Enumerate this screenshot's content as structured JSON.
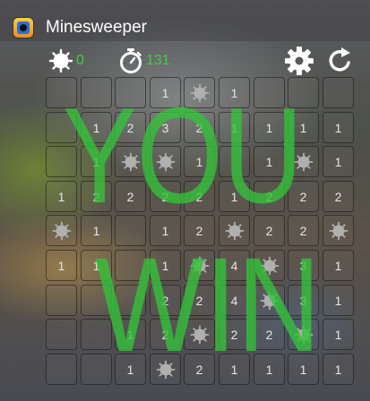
{
  "app": {
    "title": "Minesweeper"
  },
  "toolbar": {
    "flags": "0",
    "time": "131"
  },
  "colors": {
    "accent": "#3fd13c",
    "overlay": "#35c23b"
  },
  "overlay": {
    "line1": "YOU",
    "line2": "WIN"
  },
  "board": {
    "rows": [
      [
        "",
        "",
        "",
        "1",
        "m",
        "1",
        "",
        "",
        ""
      ],
      [
        "",
        "1",
        "2",
        "3",
        "2",
        "1",
        "1",
        "1",
        "1"
      ],
      [
        "",
        "1",
        "m",
        "m",
        "1",
        "",
        "1",
        "m",
        "1"
      ],
      [
        "1",
        "2",
        "2",
        "2",
        "2",
        "1",
        "2",
        "2",
        "2"
      ],
      [
        "m",
        "1",
        "",
        "1",
        "2",
        "m",
        "2",
        "2",
        "m"
      ],
      [
        "1",
        "1",
        "",
        "1",
        "m",
        "4",
        "m",
        "3",
        "1"
      ],
      [
        "",
        "",
        "",
        "2",
        "2",
        "4",
        "m",
        "3",
        "1"
      ],
      [
        "",
        "",
        "1",
        "2",
        "m",
        "2",
        "2",
        "m",
        "1"
      ],
      [
        "",
        "",
        "1",
        "m",
        "2",
        "1",
        "1",
        "1",
        "1"
      ]
    ]
  }
}
